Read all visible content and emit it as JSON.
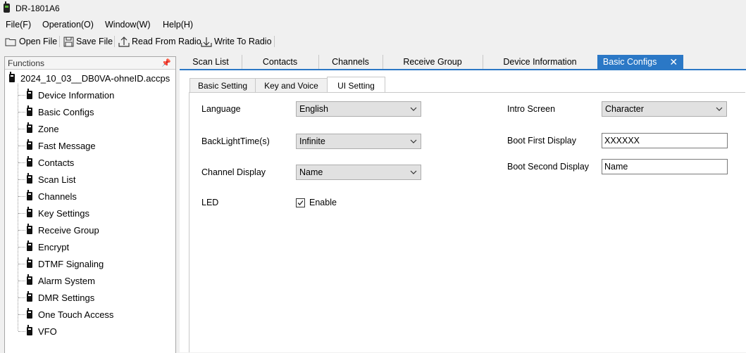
{
  "window": {
    "title": "DR-1801A6"
  },
  "menu": [
    "File(F)",
    "Operation(O)",
    "Window(W)",
    "Help(H)"
  ],
  "toolbar": {
    "open": "Open File",
    "save": "Save File",
    "read": "Read From Radio",
    "write": "Write To Radio"
  },
  "functions": {
    "header": "Functions",
    "pin_icon": "pin-icon",
    "root": "2024_10_03__DB0VA-ohneID.accps",
    "items": [
      "Device Information",
      "Basic Configs",
      "Zone",
      "Fast Message",
      "Contacts",
      "Scan List",
      "Channels",
      "Key Settings",
      "Receive Group",
      "Encrypt",
      "DTMF Signaling",
      "Alarm System",
      "DMR Settings",
      "One Touch Access",
      "VFO"
    ]
  },
  "tabs": [
    "Scan List",
    "Contacts",
    "Channels",
    "Receive Group",
    "Device Information",
    "Basic Configs"
  ],
  "active_tab": "Basic Configs",
  "subtabs": [
    "Basic Setting",
    "Key and Voice",
    "UI Setting"
  ],
  "active_subtab": "UI Setting",
  "form": {
    "language": {
      "label": "Language",
      "value": "English"
    },
    "backlight": {
      "label": "BackLightTime(s)",
      "value": "Infinite"
    },
    "channel_display": {
      "label": "Channel Display",
      "value": "Name"
    },
    "led": {
      "label": "LED",
      "checkbox_label": "Enable",
      "checked": true
    },
    "intro_screen": {
      "label": "Intro Screen",
      "value": "Character"
    },
    "boot_first": {
      "label": "Boot First Display",
      "value": "XXXXXX"
    },
    "boot_second": {
      "label": "Boot Second Display",
      "value": "Name"
    }
  },
  "colors": {
    "accent": "#2b78c6",
    "background": "#f0f0f0"
  }
}
